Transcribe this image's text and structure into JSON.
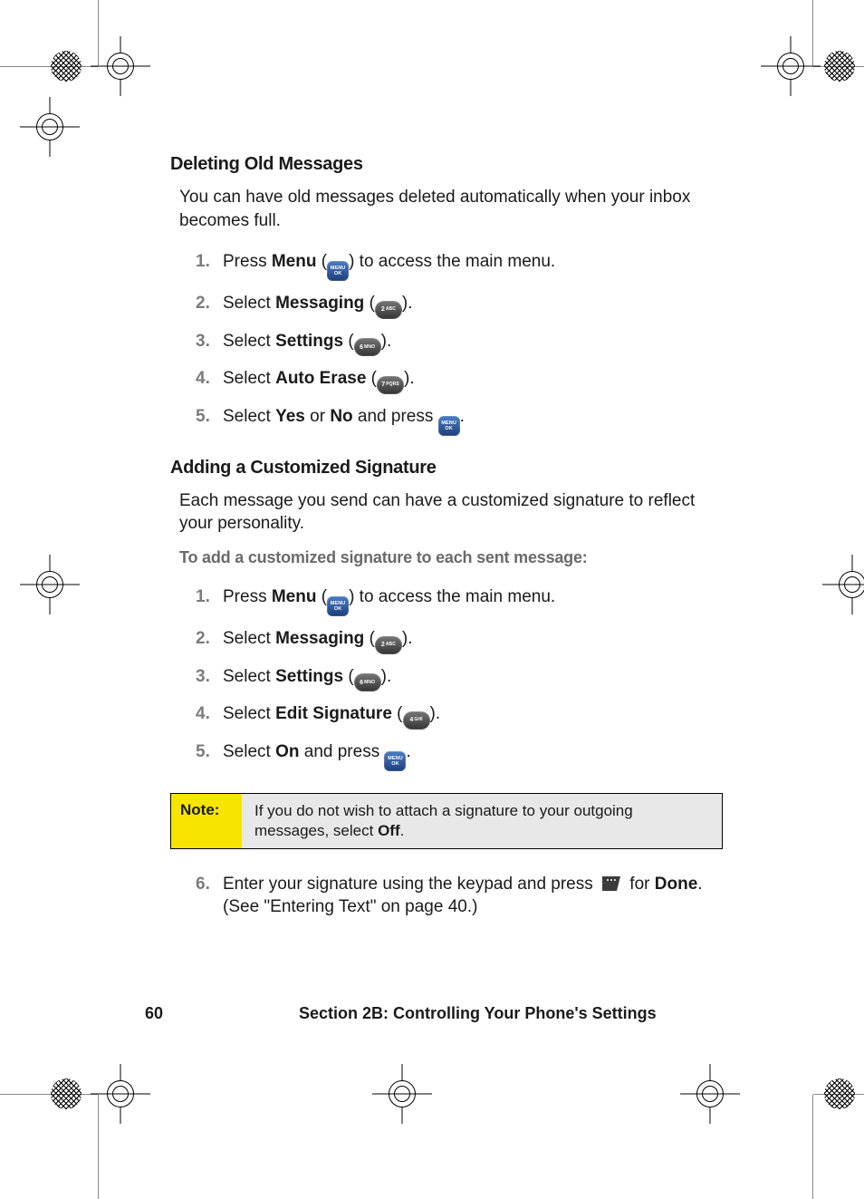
{
  "heading1": "Deleting Old Messages",
  "intro1": "You can have old messages deleted automatically when your inbox becomes full.",
  "heading2": "Adding a Customized Signature",
  "intro2": "Each message you send can have a customized signature to reflect your personality.",
  "leadin2": "To add a customized signature to each sent message:",
  "note_label": "Note:",
  "note_text_a": "If you do not wish to attach a signature to your outgoing messages, select ",
  "note_text_b": "Off",
  "note_text_c": ".",
  "footer_page": "60",
  "footer_section": "Section 2B: Controlling Your Phone's Settings",
  "steps1": {
    "s1": {
      "num": "1.",
      "a": "Press ",
      "b": "Menu",
      "c": " (",
      "d": ") to access the main menu."
    },
    "s2": {
      "num": "2.",
      "a": "Select ",
      "b": "Messaging",
      "c": " (",
      "d": ")."
    },
    "s3": {
      "num": "3.",
      "a": "Select ",
      "b": "Settings",
      "c": " (",
      "d": ")."
    },
    "s4": {
      "num": "4.",
      "a": "Select ",
      "b": "Auto Erase",
      "c": " (",
      "d": ")."
    },
    "s5": {
      "num": "5.",
      "a": "Select ",
      "b": "Yes",
      "c": " or ",
      "d": "No",
      "e": " and press ",
      "f": "."
    }
  },
  "steps2": {
    "s1": {
      "num": "1.",
      "a": "Press ",
      "b": "Menu",
      "c": " (",
      "d": ") to access the main menu."
    },
    "s2": {
      "num": "2.",
      "a": "Select ",
      "b": "Messaging",
      "c": " (",
      "d": ")."
    },
    "s3": {
      "num": "3.",
      "a": "Select ",
      "b": "Settings",
      "c": " (",
      "d": ")."
    },
    "s4": {
      "num": "4.",
      "a": "Select ",
      "b": "Edit Signature",
      "c": " (",
      "d": ")."
    },
    "s5": {
      "num": "5.",
      "a": "Select ",
      "b": "On",
      "c": " and press ",
      "d": "."
    },
    "s6": {
      "num": "6.",
      "a": "Enter your signature using the keypad and press ",
      "b": " for ",
      "c": "Done",
      "d": ". (See \"Entering Text\" on page 40.)"
    }
  },
  "menu_key": {
    "top": "MENU",
    "bottom": "OK"
  }
}
